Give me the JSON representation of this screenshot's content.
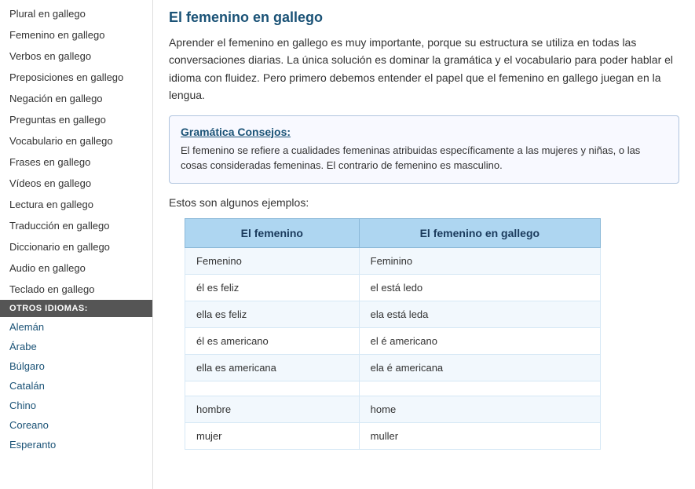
{
  "sidebar": {
    "items": [
      {
        "label": "Plural en gallego",
        "href": "#"
      },
      {
        "label": "Femenino en gallego",
        "href": "#"
      },
      {
        "label": "Verbos en gallego",
        "href": "#"
      },
      {
        "label": "Preposiciones en gallego",
        "href": "#"
      },
      {
        "label": "Negación en gallego",
        "href": "#"
      },
      {
        "label": "Preguntas en gallego",
        "href": "#"
      },
      {
        "label": "Vocabulario en gallego",
        "href": "#"
      },
      {
        "label": "Frases en gallego",
        "href": "#"
      },
      {
        "label": "Vídeos en gallego",
        "href": "#"
      },
      {
        "label": "Lectura en gallego",
        "href": "#"
      },
      {
        "label": "Traducción en gallego",
        "href": "#"
      },
      {
        "label": "Diccionario en gallego",
        "href": "#"
      },
      {
        "label": "Audio en gallego",
        "href": "#"
      },
      {
        "label": "Teclado en gallego",
        "href": "#"
      }
    ],
    "other_languages_header": "OTROS IDIOMAS:",
    "language_links": [
      {
        "label": "Alemán",
        "href": "#"
      },
      {
        "label": "Árabe",
        "href": "#"
      },
      {
        "label": "Búlgaro",
        "href": "#"
      },
      {
        "label": "Catalán",
        "href": "#"
      },
      {
        "label": "Chino",
        "href": "#"
      },
      {
        "label": "Coreano",
        "href": "#"
      },
      {
        "label": "Esperanto",
        "href": "#"
      }
    ]
  },
  "main": {
    "page_title": "El femenino en gallego",
    "intro": "Aprender el femenino en gallego es muy importante, porque su estructura se utiliza en todas las conversaciones diarias. La única solución es dominar la gramática y el vocabulario para poder hablar el idioma con fluidez. Pero primero debemos entender el papel que el femenino en gallego juegan en la lengua.",
    "grammar_box": {
      "title": "Gramática Consejos:",
      "text": "El femenino se refiere a cualidades femeninas atribuidas específicamente a las mujeres y niñas, o las cosas consideradas femeninas. El contrario de femenino es masculino."
    },
    "examples_intro": "Estos son algunos ejemplos:",
    "table": {
      "col1_header": "El femenino",
      "col2_header": "El femenino en gallego",
      "rows": [
        {
          "col1": "Femenino",
          "col2": "Feminino",
          "separator": false
        },
        {
          "col1": "él es feliz",
          "col2": "el está ledo",
          "separator": false
        },
        {
          "col1": "ella es feliz",
          "col2": "ela está leda",
          "separator": false
        },
        {
          "col1": "él es americano",
          "col2": "el é americano",
          "separator": false
        },
        {
          "col1": "ella es americana",
          "col2": "ela é americana",
          "separator": false
        },
        {
          "col1": "",
          "col2": "",
          "separator": true
        },
        {
          "col1": "hombre",
          "col2": "home",
          "separator": false
        },
        {
          "col1": "mujer",
          "col2": "muller",
          "separator": false
        }
      ]
    }
  }
}
